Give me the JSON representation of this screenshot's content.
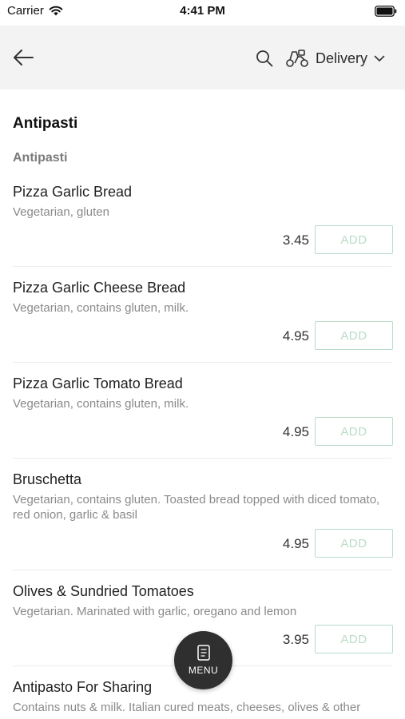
{
  "status_bar": {
    "carrier": "Carrier",
    "time": "4:41 PM"
  },
  "nav": {
    "back_icon": "back-arrow-icon",
    "search_icon": "search-icon",
    "delivery_icon": "scooter-icon",
    "delivery_label": "Delivery",
    "chevron_icon": "chevron-down-icon"
  },
  "menu": {
    "section_title": "Antipasti",
    "subsection_title": "Antipasti",
    "add_label": "ADD",
    "items": [
      {
        "name": "Pizza Garlic Bread",
        "description": "Vegetarian, gluten",
        "price": "3.45"
      },
      {
        "name": "Pizza Garlic Cheese Bread",
        "description": "Vegetarian, contains gluten, milk.",
        "price": "4.95"
      },
      {
        "name": "Pizza Garlic Tomato Bread",
        "description": "Vegetarian, contains gluten, milk.",
        "price": "4.95"
      },
      {
        "name": "Bruschetta",
        "description": "Vegetarian, contains gluten. Toasted bread topped with diced tomato, red onion, garlic & basil",
        "price": "4.95"
      },
      {
        "name": "Olives & Sundried Tomatoes",
        "description": "Vegetarian. Marinated with garlic, oregano and lemon",
        "price": "3.95"
      },
      {
        "name": "Antipasto For Sharing",
        "description": "Contains nuts & milk. Italian cured meats, cheeses, olives & other"
      }
    ]
  },
  "fab": {
    "label": "MENU",
    "icon": "menu-book-icon"
  },
  "colors": {
    "nav_background": "#f3f3f3",
    "add_button_accent": "#b9dcc8",
    "fab_background": "#2f2f2f"
  }
}
